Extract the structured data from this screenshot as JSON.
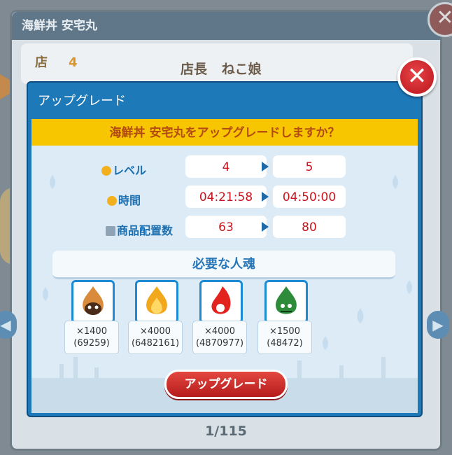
{
  "background": {
    "shop_title": "海鮮丼 安宅丸",
    "shop_level_label": "店",
    "shop_level": "4",
    "manager_label": "店長",
    "manager_name": "ねこ娘",
    "pager": "1/115",
    "close_glyph": "✕",
    "prev_glyph": "◀",
    "next_glyph": "▶"
  },
  "dialog": {
    "title": "アップグレード",
    "question": "海鮮丼 安宅丸をアップグレードしますか？",
    "close_glyph": "✕",
    "stats": [
      {
        "label": "レベル",
        "icon": "level-icon",
        "from": "4",
        "to": "5"
      },
      {
        "label": "時間",
        "icon": "clock-icon",
        "from": "04:21:58",
        "to": "04:50:00"
      },
      {
        "label": "商品配置数",
        "icon": "stack-icon",
        "from": "63",
        "to": "80"
      }
    ],
    "required_label": "必要な人魂",
    "souls": [
      {
        "icon": "brown-soul-icon",
        "amount": "×1400",
        "owned": "(69259)",
        "color": "#7a4a2a"
      },
      {
        "icon": "yellow-soul-icon",
        "amount": "×4000",
        "owned": "(6482161)",
        "color": "#f2a81d"
      },
      {
        "icon": "red-soul-icon",
        "amount": "×4000",
        "owned": "(4870977)",
        "color": "#e3231d"
      },
      {
        "icon": "green-soul-icon",
        "amount": "×1500",
        "owned": "(48472)",
        "color": "#2e8b3a"
      }
    ],
    "upgrade_button": "アップグレード"
  },
  "colors": {
    "dialog_blue": "#1e79b9",
    "banner_yellow": "#f7c600",
    "value_red": "#c8141c",
    "button_red": "#c8261f"
  }
}
